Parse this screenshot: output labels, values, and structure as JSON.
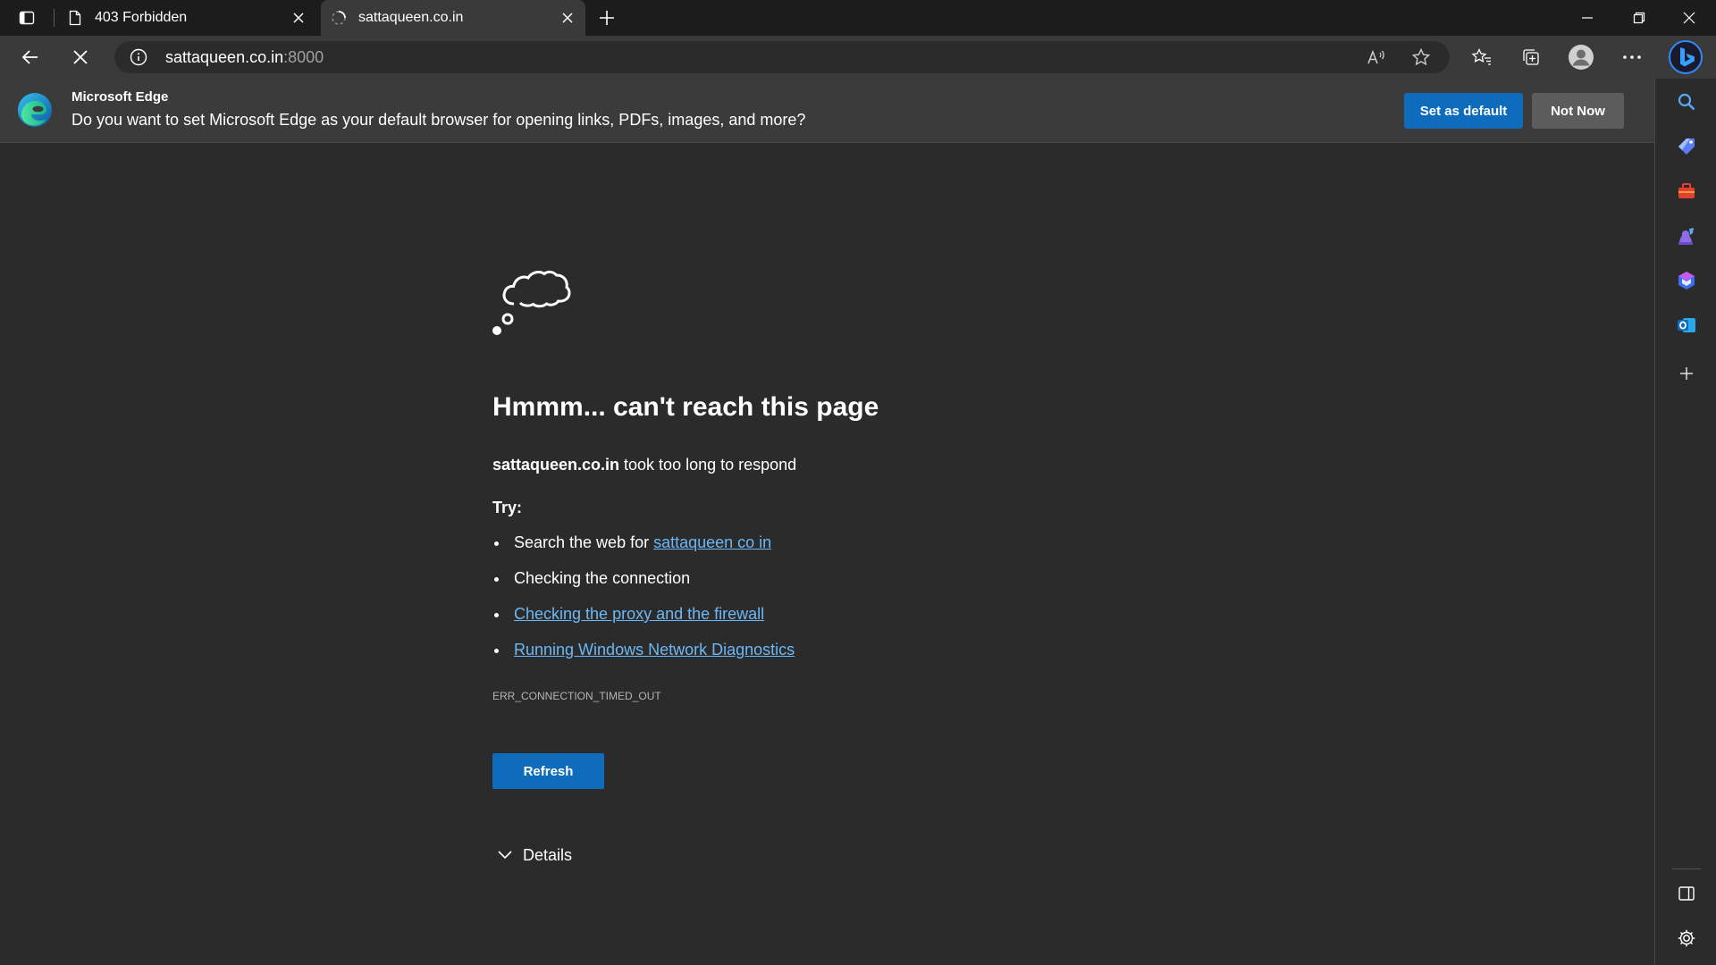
{
  "tabs": [
    {
      "title": "403 Forbidden",
      "state": "inactive"
    },
    {
      "title": "sattaqueen.co.in",
      "state": "active-loading"
    }
  ],
  "address": {
    "host": "sattaqueen.co.in",
    "port": ":8000"
  },
  "notification": {
    "title": "Microsoft Edge",
    "message": "Do you want to set Microsoft Edge as your default browser for opening links, PDFs, images, and more?",
    "primary_label": "Set as default",
    "secondary_label": "Not Now"
  },
  "error": {
    "heading": "Hmmm... can't reach this page",
    "host": "sattaqueen.co.in",
    "host_suffix": " took too long to respond",
    "try_label": "Try:",
    "suggestions": {
      "search_prefix": "Search the web for ",
      "search_link": "sattaqueen co in",
      "connection": "Checking the connection",
      "proxy_link": "Checking the proxy and the firewall",
      "diagnostics_link": "Running Windows Network Diagnostics"
    },
    "code": "ERR_CONNECTION_TIMED_OUT",
    "refresh_label": "Refresh",
    "details_label": "Details"
  },
  "icons": {
    "tab_actions": "tab-actions-icon",
    "page": "page-icon",
    "loading": "loading-spinner-icon",
    "read_aloud": "read-aloud-icon",
    "favorite": "star-icon",
    "favorites": "favorites-icon",
    "collections": "collections-icon",
    "profile": "profile-icon",
    "more": "more-icon",
    "copilot": "bing-copilot-icon"
  },
  "colors": {
    "accent": "#0f6cbd",
    "link": "#6cb8f6",
    "page_bg": "#2b2b2b",
    "chrome_bg": "#3a3a3a",
    "tabstrip_bg": "#1c1c1c"
  }
}
